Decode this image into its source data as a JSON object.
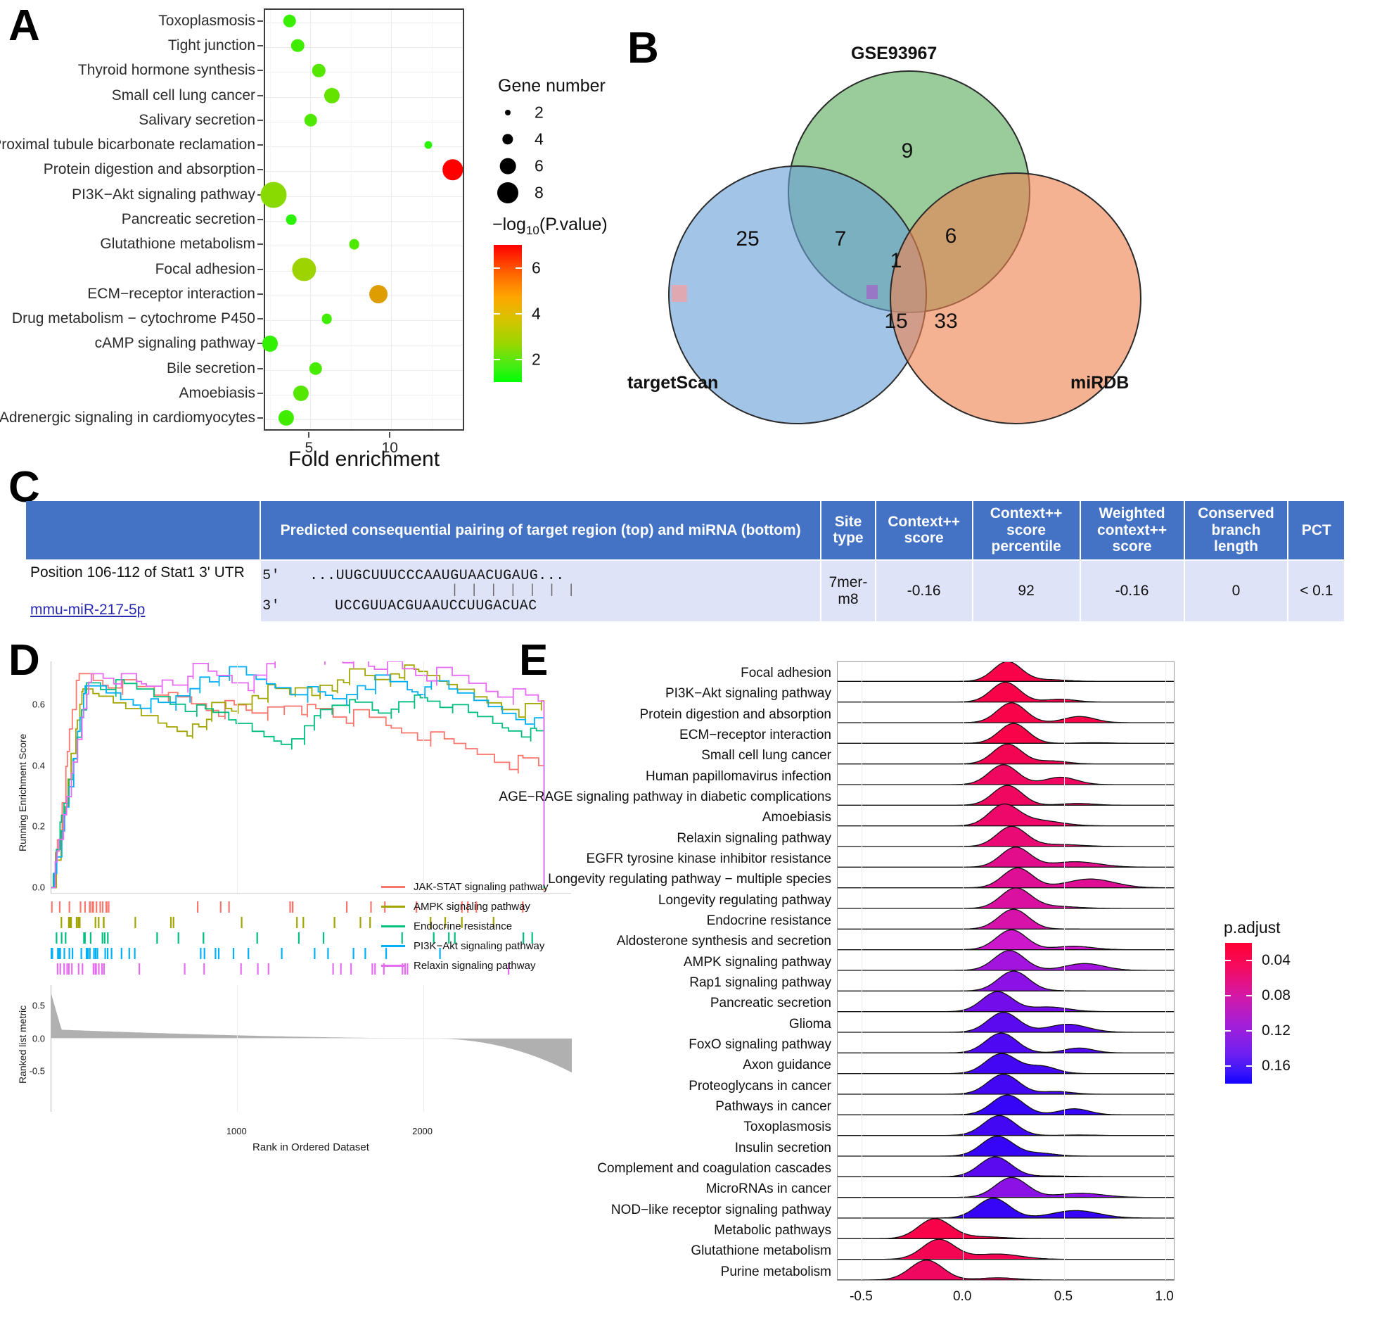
{
  "panels": {
    "a": {
      "letter": "A"
    },
    "b": {
      "letter": "B"
    },
    "c": {
      "letter": "C"
    },
    "d": {
      "letter": "D"
    },
    "e": {
      "letter": "E"
    }
  },
  "chart_data": [
    {
      "type": "scatter",
      "panel": "A",
      "title": "",
      "xlabel": "Fold enrichment",
      "ylabel": "",
      "xlim": [
        2.2,
        14.6
      ],
      "xticks": [
        5,
        10
      ],
      "grid": true,
      "size_legend": {
        "title": "Gene number",
        "values": [
          2,
          4,
          6,
          8
        ]
      },
      "color_legend": {
        "title": "−log10(P.value)",
        "ticks": [
          6,
          4,
          2
        ],
        "low_color": "#00ff00",
        "mid_color": "#d4c400",
        "high_color": "#ff0000",
        "range": [
          1.0,
          7.0
        ]
      },
      "categories": [
        "Toxoplasmosis",
        "Tight junction",
        "Thyroid hormone synthesis",
        "Small cell lung cancer",
        "Salivary secretion",
        "Proximal tubule bicarbonate reclamation",
        "Protein digestion and absorption",
        "PI3K−Akt signaling pathway",
        "Pancreatic secretion",
        "Glutathione metabolism",
        "Focal adhesion",
        "ECM−receptor interaction",
        "Drug metabolism − cytochrome P450",
        "cAMP signaling pathway",
        "Bile secretion",
        "Amoebiasis",
        "Adrenergic signaling in cardiomyocytes"
      ],
      "points": [
        {
          "category": "Toxoplasmosis",
          "fold_enrichment": 3.8,
          "gene_number": 4,
          "neglog10p": 1.8
        },
        {
          "category": "Tight junction",
          "fold_enrichment": 4.3,
          "gene_number": 4,
          "neglog10p": 1.9
        },
        {
          "category": "Thyroid hormone synthesis",
          "fold_enrichment": 5.6,
          "gene_number": 4,
          "neglog10p": 2.2
        },
        {
          "category": "Small cell lung cancer",
          "fold_enrichment": 6.4,
          "gene_number": 5,
          "neglog10p": 2.4
        },
        {
          "category": "Salivary secretion",
          "fold_enrichment": 5.1,
          "gene_number": 4,
          "neglog10p": 2.1
        },
        {
          "category": "Proximal tubule bicarbonate reclamation",
          "fold_enrichment": 12.4,
          "gene_number": 2,
          "neglog10p": 1.6
        },
        {
          "category": "Protein digestion and absorption",
          "fold_enrichment": 13.9,
          "gene_number": 7,
          "neglog10p": 7.0
        },
        {
          "category": "PI3K−Akt signaling pathway",
          "fold_enrichment": 2.8,
          "gene_number": 9,
          "neglog10p": 2.9
        },
        {
          "category": "Pancreatic secretion",
          "fold_enrichment": 3.9,
          "gene_number": 3,
          "neglog10p": 1.6
        },
        {
          "category": "Glutathione metabolism",
          "fold_enrichment": 7.8,
          "gene_number": 3,
          "neglog10p": 2.1
        },
        {
          "category": "Focal adhesion",
          "fold_enrichment": 4.7,
          "gene_number": 8,
          "neglog10p": 3.2
        },
        {
          "category": "ECM−receptor interaction",
          "fold_enrichment": 9.3,
          "gene_number": 6,
          "neglog10p": 4.6
        },
        {
          "category": "Drug metabolism − cytochrome P450",
          "fold_enrichment": 6.1,
          "gene_number": 3,
          "neglog10p": 1.9
        },
        {
          "category": "cAMP signaling pathway",
          "fold_enrichment": 2.6,
          "gene_number": 5,
          "neglog10p": 1.7
        },
        {
          "category": "Bile secretion",
          "fold_enrichment": 5.4,
          "gene_number": 4,
          "neglog10p": 2.0
        },
        {
          "category": "Amoebiasis",
          "fold_enrichment": 4.5,
          "gene_number": 5,
          "neglog10p": 2.2
        },
        {
          "category": "Adrenergic signaling in cardiomyocytes",
          "fold_enrichment": 3.6,
          "gene_number": 5,
          "neglog10p": 1.9
        }
      ]
    },
    {
      "type": "venn",
      "panel": "B",
      "sets": [
        "GSE93967",
        "targetScan",
        "miRDB"
      ],
      "regions": [
        {
          "label": "GSE93967 only",
          "value": 9
        },
        {
          "label": "targetScan only",
          "value": 25
        },
        {
          "label": "miRDB only",
          "value": 33
        },
        {
          "label": "GSE93967 ∩ targetScan",
          "value": 7
        },
        {
          "label": "GSE93967 ∩ miRDB",
          "value": 6
        },
        {
          "label": "targetScan ∩ miRDB",
          "value": 15
        },
        {
          "label": "all three",
          "value": 1
        }
      ],
      "colors": {
        "GSE93967": "#5aab5d",
        "targetScan": "#7ba7d7",
        "miRDB": "#ea9367"
      }
    },
    {
      "type": "line",
      "panel": "D",
      "title": "",
      "xlabel": "Rank in Ordered Dataset",
      "ylabel": "Running Enrichment Score",
      "ylabel2": "Ranked list metric",
      "xlim": [
        0,
        2800
      ],
      "xticks": [
        1000,
        2000
      ],
      "yticks_top": [
        0.0,
        0.2,
        0.4,
        0.6
      ],
      "yticks_bottom": [
        -0.5,
        0.0,
        0.5
      ],
      "series": [
        {
          "name": "JAK-STAT signaling pathway",
          "color": "#f8766d",
          "peak": 0.7
        },
        {
          "name": "AMPK signaling pathway",
          "color": "#a3a500",
          "peak": 0.65
        },
        {
          "name": "Endocrine resistance",
          "color": "#00bf7d",
          "peak": 0.67
        },
        {
          "name": "PI3K−Akt signaling pathway",
          "color": "#00b0f6",
          "peak": 0.66
        },
        {
          "name": "Relaxin signaling pathway",
          "color": "#e76bf3",
          "peak": 0.7
        }
      ]
    },
    {
      "type": "ridgeline",
      "panel": "E",
      "title": "",
      "xlabel": "",
      "xlim": [
        -0.62,
        1.05
      ],
      "xticks": [
        -0.5,
        0.0,
        0.5,
        1.0
      ],
      "color_legend": {
        "title": "p.adjust",
        "ticks": [
          0.04,
          0.08,
          0.12,
          0.16
        ],
        "high_color": "#ff0033",
        "low_color": "#1200ff"
      },
      "categories": [
        {
          "label": "Focal adhesion",
          "p_adjust": 0.03,
          "peak_x": 0.22
        },
        {
          "label": "PI3K−Akt signaling pathway",
          "p_adjust": 0.03,
          "peak_x": 0.21
        },
        {
          "label": "Protein digestion and absorption",
          "p_adjust": 0.03,
          "peak_x": 0.24
        },
        {
          "label": "ECM−receptor interaction",
          "p_adjust": 0.03,
          "peak_x": 0.25
        },
        {
          "label": "Small cell lung cancer",
          "p_adjust": 0.035,
          "peak_x": 0.22
        },
        {
          "label": "Human papillomavirus infection",
          "p_adjust": 0.04,
          "peak_x": 0.2
        },
        {
          "label": "AGE−RAGE signaling pathway in diabetic complications",
          "p_adjust": 0.04,
          "peak_x": 0.22
        },
        {
          "label": "Amoebiasis",
          "p_adjust": 0.045,
          "peak_x": 0.2
        },
        {
          "label": "Relaxin signaling pathway",
          "p_adjust": 0.05,
          "peak_x": 0.24
        },
        {
          "label": "EGFR tyrosine kinase inhibitor resistance",
          "p_adjust": 0.06,
          "peak_x": 0.26
        },
        {
          "label": "Longevity regulating pathway − multiple species",
          "p_adjust": 0.065,
          "peak_x": 0.27
        },
        {
          "label": "Longevity regulating pathway",
          "p_adjust": 0.07,
          "peak_x": 0.26
        },
        {
          "label": "Endocrine resistance",
          "p_adjust": 0.075,
          "peak_x": 0.25
        },
        {
          "label": "Aldosterone synthesis and secretion",
          "p_adjust": 0.09,
          "peak_x": 0.24
        },
        {
          "label": "AMPK signaling pathway",
          "p_adjust": 0.11,
          "peak_x": 0.23
        },
        {
          "label": "Rap1 signaling pathway",
          "p_adjust": 0.12,
          "peak_x": 0.25
        },
        {
          "label": "Pancreatic secretion",
          "p_adjust": 0.13,
          "peak_x": 0.17
        },
        {
          "label": "Glioma",
          "p_adjust": 0.14,
          "peak_x": 0.2
        },
        {
          "label": "FoxO signaling pathway",
          "p_adjust": 0.145,
          "peak_x": 0.19
        },
        {
          "label": "Axon guidance",
          "p_adjust": 0.15,
          "peak_x": 0.19
        },
        {
          "label": "Proteoglycans in cancer",
          "p_adjust": 0.15,
          "peak_x": 0.2
        },
        {
          "label": "Pathways in cancer",
          "p_adjust": 0.155,
          "peak_x": 0.22
        },
        {
          "label": "Toxoplasmosis",
          "p_adjust": 0.15,
          "peak_x": 0.18
        },
        {
          "label": "Insulin secretion",
          "p_adjust": 0.155,
          "peak_x": 0.17
        },
        {
          "label": "Complement and coagulation cascades",
          "p_adjust": 0.14,
          "peak_x": 0.16
        },
        {
          "label": "MicroRNAs in cancer",
          "p_adjust": 0.12,
          "peak_x": 0.24
        },
        {
          "label": "NOD−like receptor signaling pathway",
          "p_adjust": 0.155,
          "peak_x": 0.15
        },
        {
          "label": "Metabolic pathways",
          "p_adjust": 0.03,
          "peak_x": -0.14
        },
        {
          "label": "Glutathione metabolism",
          "p_adjust": 0.035,
          "peak_x": -0.12
        },
        {
          "label": "Purine metabolism",
          "p_adjust": 0.04,
          "peak_x": -0.18
        }
      ]
    }
  ],
  "panel_a": {
    "xaxis_title": "Fold enrichment",
    "size_legend_title": "Gene number",
    "color_legend_title_prefix": "−log",
    "color_legend_title_sub": "10",
    "color_legend_title_suffix": "(P.value)"
  },
  "panel_b": {
    "set_top": "GSE93967",
    "set_left": "targetScan",
    "set_right": "miRDB",
    "n_green_only": "9",
    "n_blue_only": "25",
    "n_orange_only": "33",
    "n_green_blue": "7",
    "n_green_orange": "6",
    "n_blue_orange": "15",
    "n_center": "1"
  },
  "panel_c": {
    "headers": [
      "",
      "Predicted consequential pairing of target region (top) and miRNA (bottom)",
      "Site type",
      "Context++ score",
      "Context++ score percentile",
      "Weighted context++ score",
      "Conserved branch length",
      "PCT"
    ],
    "row": {
      "position_label": "Position 106-112 of Stat1 3' UTR",
      "mirna_label": "mmu-miR-217-5p",
      "target_prime": "5'",
      "target_seq": "...UUGCUUUCCCAAUGUAACUGAUG...",
      "pairing_bars": "| | | | | | |",
      "mirna_prime": "3'",
      "mirna_seq": "UCCGUUACGUAAUCCUUGACUAC",
      "site_type": "7mer-m8",
      "context_score": "-0.16",
      "context_percentile": "92",
      "weighted_context_score": "-0.16",
      "conserved_branch_length": "0",
      "pct": "< 0.1"
    }
  },
  "panel_d": {
    "ylabel_top": "Running Enrichment Score",
    "ylabel_bottom": "Ranked list metric",
    "xlabel": "Rank in Ordered Dataset",
    "yticks_top": [
      "0.6",
      "0.4",
      "0.2",
      "0.0"
    ],
    "yticks_bottom": [
      "0.5",
      "0.0",
      "-0.5"
    ],
    "xticks": [
      "1000",
      "2000"
    ],
    "legend": [
      {
        "label": "JAK-STAT signaling pathway",
        "color": "#f8766d"
      },
      {
        "label": "AMPK signaling pathway",
        "color": "#a3a500"
      },
      {
        "label": "Endocrine resistance",
        "color": "#00bf7d"
      },
      {
        "label": "PI3K−Akt signaling pathway",
        "color": "#00b0f6"
      },
      {
        "label": "Relaxin signaling pathway",
        "color": "#e76bf3"
      }
    ]
  },
  "panel_e": {
    "legend_title": "p.adjust",
    "legend_ticks": [
      "0.04",
      "0.08",
      "0.12",
      "0.16"
    ],
    "xticks": [
      "-0.5",
      "0.0",
      "0.5",
      "1.0"
    ]
  }
}
